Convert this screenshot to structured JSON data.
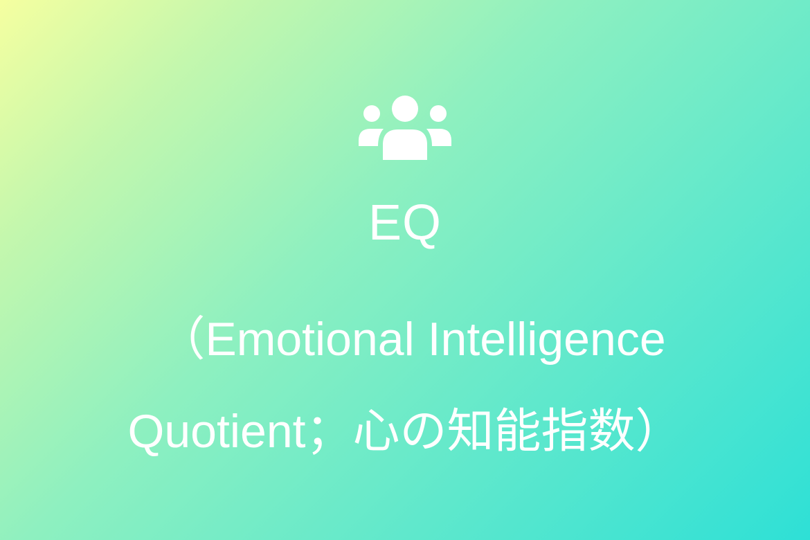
{
  "icon": "users-group-icon",
  "colors": {
    "gradient_start": "#f5ffa0",
    "gradient_mid": "#8ef0c0",
    "gradient_end": "#2ee0d6",
    "text": "#ffffff"
  },
  "title": "EQ",
  "subtitle_line1": "（Emotional Intelligence",
  "subtitle_line2": "Quotient；心の知能指数）"
}
